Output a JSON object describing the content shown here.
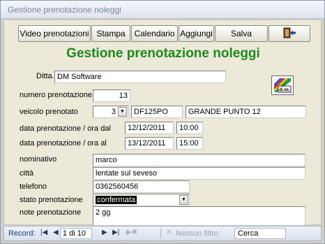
{
  "window": {
    "title": "Gestione prenotazione noleggi"
  },
  "toolbar": {
    "video": "Video prenotazioni",
    "stampa": "Stampa",
    "calendario": "Calendario",
    "aggiungi": "Aggiungi",
    "salva": "Salva"
  },
  "form": {
    "heading": "Gestione prenotazione noleggi",
    "ditta_label": "Ditta.:",
    "ditta_value": "DM Software",
    "numero_label": "numero prenotazione",
    "numero_value": "13",
    "veicolo_label": "veicolo prenotato",
    "veicolo_id": "3",
    "veicolo_targa": "DF125PO",
    "veicolo_modello": "GRANDE PUNTO 12",
    "dal_label": "data prenotazione / ora dal",
    "dal_data": "12/12/2011",
    "dal_ora": "10:00",
    "al_label": "data prenotazione / ora al",
    "al_data": "13/12/2011",
    "al_ora": "15:00",
    "nominativo_label": "nominativo",
    "nominativo_value": "marco",
    "citta_label": "città",
    "citta_value": "lentate sul seveso",
    "telefono_label": "telefono",
    "telefono_value": "0362560456",
    "stato_label": "stato prenotazione",
    "stato_value": "confermata",
    "note_label": "note prenotazione",
    "note_value": "2 gg"
  },
  "statusbar": {
    "record_label": "Record:",
    "record_value": "1 di 10",
    "filter": "Nessun filtro",
    "search_placeholder": "Cerca"
  },
  "colors": {
    "heading": "#1c8a1c",
    "stato_highlight": "#000000"
  },
  "icons": [
    "exit-door-icon",
    "dm-logo-icon",
    "chevron-down-icon",
    "record-nav-first-icon",
    "record-nav-prev-icon",
    "record-nav-next-icon",
    "record-nav-last-icon",
    "record-new-icon",
    "filter-icon"
  ]
}
